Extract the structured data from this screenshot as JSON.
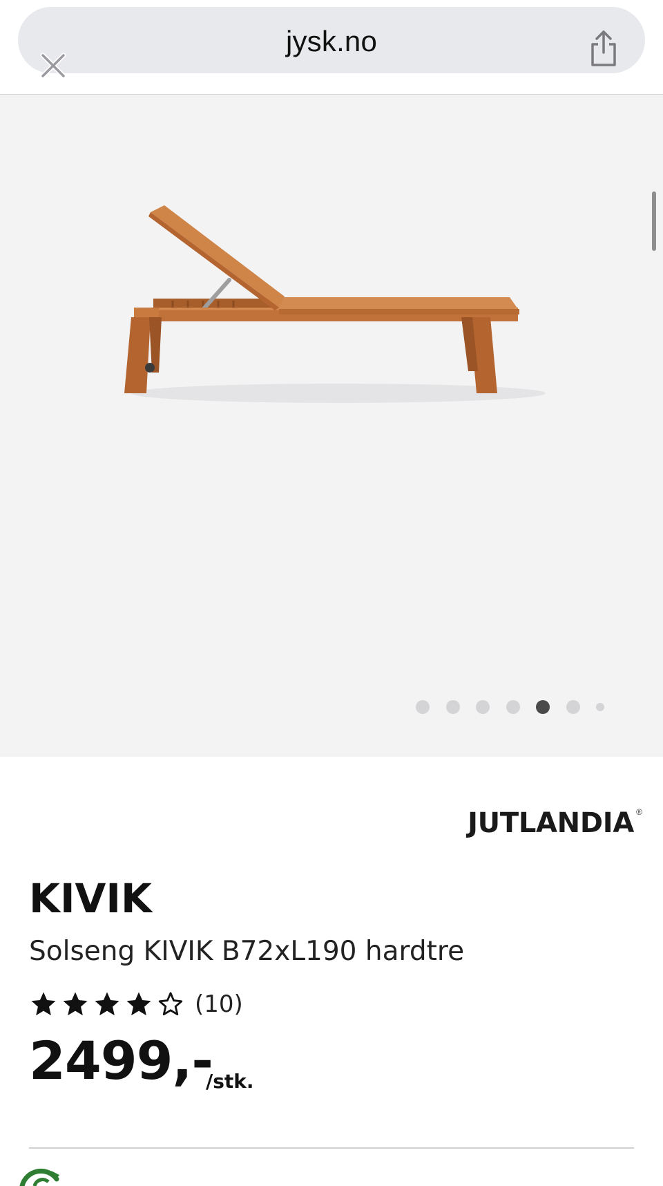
{
  "browser": {
    "url": "jysk.no",
    "icons": {
      "close": "close-icon",
      "share": "share-icon"
    }
  },
  "gallery": {
    "image_alt": "Solseng KIVIK",
    "dots_total": 7,
    "active_index": 4
  },
  "product": {
    "brand": "JUTLANDIA",
    "brand_mark": "®",
    "name": "KIVIK",
    "description": "Solseng KIVIK B72xL190 hardtre",
    "rating_stars": 4,
    "rating_max": 5,
    "review_count": "(10)",
    "price": "2499,-",
    "price_unit": "/stk."
  },
  "colors": {
    "wood": "#c97a3e",
    "wood_dark": "#a75e2a",
    "eco_green": "#2f7d32"
  }
}
